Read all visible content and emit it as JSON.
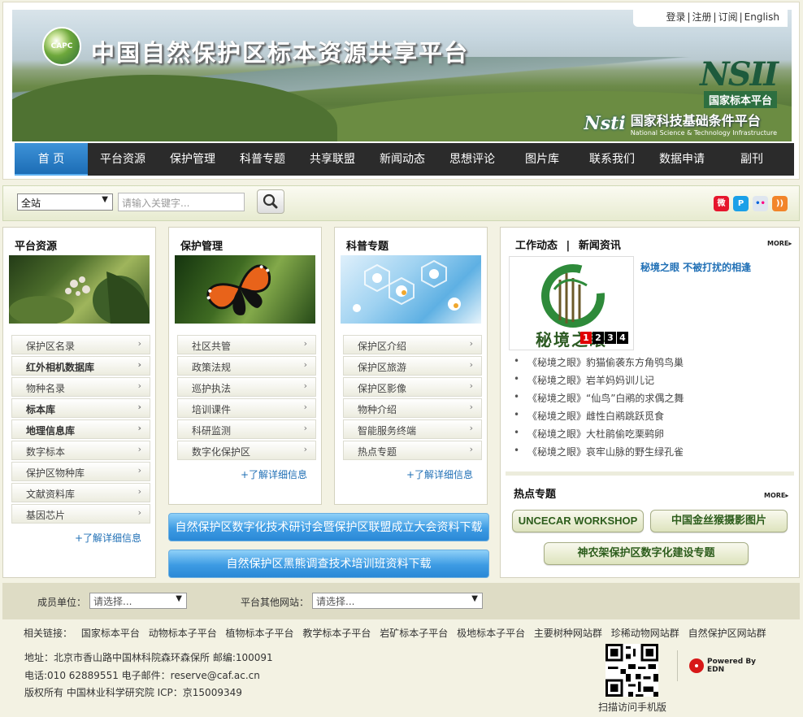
{
  "header": {
    "logo_text": "CAPC",
    "site_title": "中国自然保护区标本资源共享平台",
    "top_links": [
      "登录",
      "注册",
      "订阅",
      "English"
    ],
    "nsii_mark": "NSII",
    "nsii_sub": "国家标本平台",
    "nsti_mark": "Nsti",
    "nsti_cn": "国家科技基础条件平台",
    "nsti_en": "National Science & Technology Infrastructure"
  },
  "nav": {
    "items": [
      "首 页",
      "平台资源",
      "保护管理",
      "科普专题",
      "共享联盟",
      "新闻动态",
      "思想评论",
      "图片库",
      "联系我们",
      "数据申请",
      "副刊"
    ],
    "active_index": 0
  },
  "search": {
    "scope_value": "全站",
    "placeholder": "请输入关键字...",
    "button_icon": "search-icon",
    "social": [
      {
        "name": "weibo-icon",
        "color": "#e6162d"
      },
      {
        "name": "pinterest-icon",
        "color": "#1aa0e8"
      },
      {
        "name": "flickr-icon",
        "color": "#dfe6ef"
      },
      {
        "name": "rss-icon",
        "color": "#f2852a"
      }
    ]
  },
  "columns": [
    {
      "title": "平台资源",
      "items": [
        "保护区名录",
        "红外相机数据库",
        "物种名录",
        "标本库",
        "地理信息库",
        "数字标本",
        "保护区物种库",
        "文献资料库",
        "基因芯片"
      ],
      "bold": [
        1,
        3,
        4
      ],
      "more": "+了解详细信息"
    },
    {
      "title": "保护管理",
      "items": [
        "社区共管",
        "政策法规",
        "巡护执法",
        "培训课件",
        "科研监测",
        "数字化保护区"
      ],
      "bold": [],
      "more": "+了解详细信息"
    },
    {
      "title": "科普专题",
      "items": [
        "保护区介绍",
        "保护区旅游",
        "保护区影像",
        "物种介绍",
        "智能服务终端",
        "热点专题"
      ],
      "bold": [],
      "more": "+了解详细信息"
    }
  ],
  "downloads": [
    "自然保护区数字化技术研讨会暨保护区联盟成立大会资料下载",
    "自然保护区黑熊调查技术培训班资料下载"
  ],
  "news": {
    "tab1": "工作动态",
    "divider": "|",
    "tab2": "新闻资讯",
    "more": "MORE▸",
    "headline": "秘境之眼 不被打扰的相逢",
    "image_caption": "秘境之眼",
    "pager": [
      "1",
      "2",
      "3",
      "4"
    ],
    "pager_active": 0,
    "items": [
      "《秘境之眼》豹猫偷袭东方角鸮鸟巢",
      "《秘境之眼》岩羊妈妈训儿记",
      "《秘境之眼》“仙鸟”白鹇的求偶之舞",
      "《秘境之眼》雌性白鹇跳跃觅食",
      "《秘境之眼》大杜鹃偷吃栗鹀卵",
      "《秘境之眼》哀牢山脉的野生绿孔雀"
    ]
  },
  "hot": {
    "title": "热点专题",
    "more": "MORE▸",
    "buttons": [
      "UNCECAR WORKSHOP",
      "中国金丝猴摄影图片",
      "神农架保护区数字化建设专题"
    ]
  },
  "footer": {
    "member_label": "成员单位：",
    "member_select": "请选择...",
    "other_label": "平台其他网站：",
    "other_select": "请选择...",
    "links_label": "相关链接：",
    "links": [
      "国家标本平台",
      "动物标本子平台",
      "植物标本子平台",
      "教学标本子平台",
      "岩矿标本子平台",
      "极地标本子平台",
      "主要树种网站群",
      "珍稀动物网站群",
      "自然保护区网站群"
    ],
    "address": "地址：北京市香山路中国林科院森环森保所   邮编:100091",
    "contact": "电话:010 62889551   电子邮件：reserve@caf.ac.cn",
    "copyright": "版权所有 中国林业科学研究院 ICP：京15009349",
    "qr_caption": "扫描访问手机版",
    "powered_line1": "Powered By",
    "powered_line2": "EDN"
  }
}
